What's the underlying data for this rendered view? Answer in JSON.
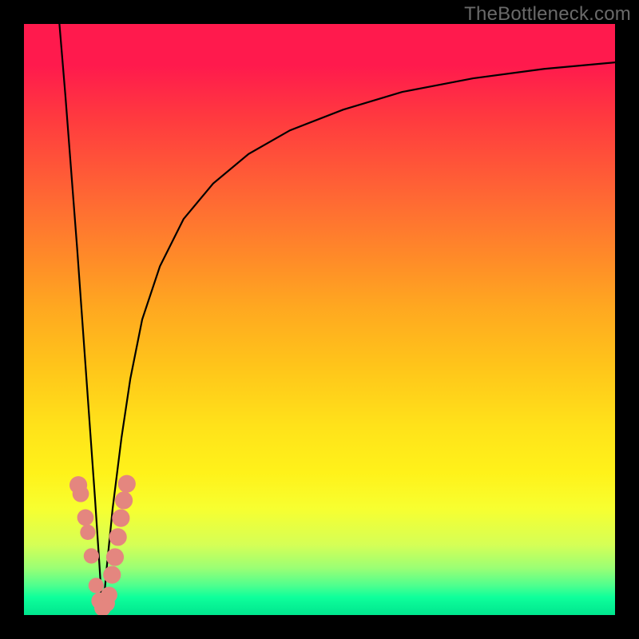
{
  "attribution": "TheBottleneck.com",
  "colors": {
    "frame": "#000000",
    "curve_stroke": "#000000",
    "dot_fill": "#e4867f",
    "gradient_stops": [
      {
        "pos": 0.0,
        "hex": "#ff1a4d"
      },
      {
        "pos": 0.07,
        "hex": "#ff1a4d"
      },
      {
        "pos": 0.16,
        "hex": "#ff3a3f"
      },
      {
        "pos": 0.3,
        "hex": "#ff6a33"
      },
      {
        "pos": 0.4,
        "hex": "#ff8c28"
      },
      {
        "pos": 0.48,
        "hex": "#ffa820"
      },
      {
        "pos": 0.58,
        "hex": "#ffc51a"
      },
      {
        "pos": 0.68,
        "hex": "#ffe21a"
      },
      {
        "pos": 0.76,
        "hex": "#fff21a"
      },
      {
        "pos": 0.82,
        "hex": "#f7ff30"
      },
      {
        "pos": 0.88,
        "hex": "#d6ff55"
      },
      {
        "pos": 0.92,
        "hex": "#9cff74"
      },
      {
        "pos": 0.95,
        "hex": "#4eff8e"
      },
      {
        "pos": 0.97,
        "hex": "#0eff9b"
      },
      {
        "pos": 1.0,
        "hex": "#00e68e"
      }
    ]
  },
  "chart_data": {
    "type": "line",
    "title": "",
    "xlabel": "",
    "ylabel": "",
    "x_range": [
      0,
      100
    ],
    "y_range": [
      0,
      100
    ],
    "note": "Vertical gradient background (red at top → green at bottom). Two black curves forming a V with minimum near x≈13 touching y=0; left branch nearly vertical from top-left, right branch rises asymptotically toward top-right. Salmon-colored dots cluster along both branches near the bottom (roughly y 0–22).",
    "series": [
      {
        "name": "left-branch",
        "x": [
          6.0,
          7.0,
          8.0,
          9.0,
          10.0,
          11.0,
          12.0,
          12.8,
          13.3
        ],
        "y": [
          100,
          88,
          75,
          62,
          48,
          34,
          20,
          8,
          0
        ]
      },
      {
        "name": "right-branch",
        "x": [
          13.3,
          14.0,
          15.0,
          16.5,
          18.0,
          20.0,
          23.0,
          27.0,
          32.0,
          38.0,
          45.0,
          54.0,
          64.0,
          76.0,
          88.0,
          100.0
        ],
        "y": [
          0,
          8,
          18,
          30,
          40,
          50,
          59,
          67,
          73,
          78,
          82,
          85.5,
          88.5,
          90.8,
          92.4,
          93.5
        ]
      }
    ],
    "scatter": {
      "name": "dots",
      "points": [
        {
          "x": 9.2,
          "y": 22.0,
          "r": 1.5
        },
        {
          "x": 9.6,
          "y": 20.5,
          "r": 1.4
        },
        {
          "x": 10.4,
          "y": 16.5,
          "r": 1.4
        },
        {
          "x": 10.8,
          "y": 14.0,
          "r": 1.3
        },
        {
          "x": 11.4,
          "y": 10.0,
          "r": 1.3
        },
        {
          "x": 12.2,
          "y": 5.0,
          "r": 1.3
        },
        {
          "x": 12.8,
          "y": 2.4,
          "r": 1.4
        },
        {
          "x": 13.3,
          "y": 1.2,
          "r": 1.4
        },
        {
          "x": 13.9,
          "y": 2.0,
          "r": 1.5
        },
        {
          "x": 14.4,
          "y": 3.4,
          "r": 1.4
        },
        {
          "x": 14.9,
          "y": 6.8,
          "r": 1.5
        },
        {
          "x": 15.4,
          "y": 9.8,
          "r": 1.5
        },
        {
          "x": 15.9,
          "y": 13.2,
          "r": 1.5
        },
        {
          "x": 16.4,
          "y": 16.4,
          "r": 1.5
        },
        {
          "x": 16.9,
          "y": 19.4,
          "r": 1.5
        },
        {
          "x": 17.4,
          "y": 22.2,
          "r": 1.5
        }
      ]
    }
  }
}
